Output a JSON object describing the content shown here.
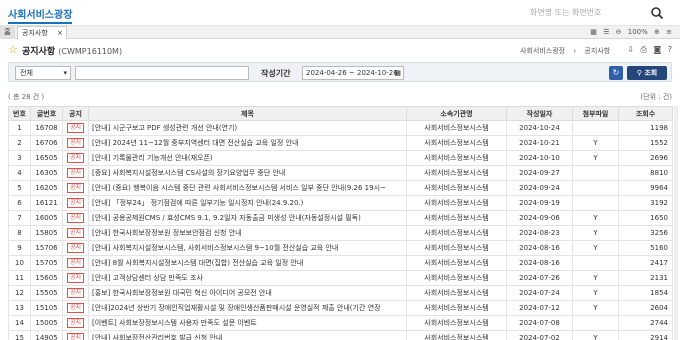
{
  "app": {
    "logo": "사회서비스광장",
    "screen_search_placeholder": "화면명 또는 화면번호"
  },
  "tabs": {
    "home": "홈",
    "active": "공지사항",
    "close": "×",
    "zoom": "100%"
  },
  "page": {
    "title": "공지사항",
    "code": "(CWMP16110M)",
    "breadcrumb": [
      "사회서비스광장",
      "공지사항"
    ]
  },
  "search": {
    "select_value": "전체",
    "keyword": "",
    "period_label": "작성기간",
    "period_value": "2024-04-26 ~ 2024-10-26",
    "query_label": "조회"
  },
  "list": {
    "count_text": "( 총 28 건 )",
    "unit_text": "(단위 : 건)",
    "headers": [
      "번호",
      "글번호",
      "공지",
      "제목",
      "소속기관명",
      "작성일자",
      "첨부파일",
      "조회수"
    ],
    "notice_badge": "공지",
    "rows": [
      [
        "1",
        "16708",
        "공지",
        "[안내] 시군구보고 PDF 생성관련 개선 안내(연기)",
        "사회서비스정보시스템",
        "2024-10-24",
        "",
        "1198"
      ],
      [
        "2",
        "16706",
        "공지",
        "[안내] 2024년 11~12월 중부지역센터 대면 전산실습 교육 일정 안내",
        "사회서비스정보시스템",
        "2024-10-21",
        "Y",
        "1552"
      ],
      [
        "3",
        "16505",
        "공지",
        "[안내] 기록물관리 기능개선 안내(재오픈)",
        "사회서비스정보시스템",
        "2024-10-10",
        "Y",
        "2696"
      ],
      [
        "4",
        "16305",
        "공지",
        "[중요] 사회복지시설정보시스템 CS사설의 장기요양업무 중단 안내",
        "사회서비스정보시스템",
        "2024-09-27",
        "",
        "8810"
      ],
      [
        "5",
        "16205",
        "공지",
        "[안내] (중요) 행복이음 시스템 중단 관련 사회서비스정보시스템 서비스 일부 중단 안내(9.26 19시~",
        "사회서비스정보시스템",
        "2024-09-24",
        "",
        "9964"
      ],
      [
        "6",
        "16121",
        "공지",
        "[안내] 「정부24」 정기점검에 따른 일부기능 일시정지 안내(24.9.20.)",
        "사회서비스정보시스템",
        "2024-09-19",
        "",
        "3192"
      ],
      [
        "7",
        "16005",
        "공지",
        "[안내] 공용공제원CMS / 효성CMS 9.1, 9.2일자 자동출금 미생성 안내(자동설정시설 필독)",
        "사회서비스정보시스템",
        "2024-09-06",
        "Y",
        "1650"
      ],
      [
        "8",
        "15805",
        "공지",
        "[안내] 한국사회보장정보원 정보보안점검 신청 안내",
        "사회서비스정보시스템",
        "2024-08-23",
        "Y",
        "3256"
      ],
      [
        "9",
        "15706",
        "공지",
        "[안내] 사회복지시설정보시스템, 사회서비스정보시스템 9~10월 전산실습 교육 안내",
        "사회서비스정보시스템",
        "2024-08-16",
        "Y",
        "5160"
      ],
      [
        "10",
        "15705",
        "공지",
        "[안내] 8월 사회복지시설정보시스템 대면(집합) 전산실습 교육 일정 안내",
        "사회서비스정보시스템",
        "2024-08-16",
        "",
        "2417"
      ],
      [
        "11",
        "15605",
        "공지",
        "[안내] 고객상담센터 상담 만족도 조사",
        "사회서비스정보시스템",
        "2024-07-26",
        "Y",
        "2131"
      ],
      [
        "12",
        "15505",
        "공지",
        "[홍보] 한국사회보장정보원 대국민 혁신 아이디어 공모전 안내",
        "사회서비스정보시스템",
        "2024-07-24",
        "Y",
        "1854"
      ],
      [
        "13",
        "15105",
        "공지",
        "[안내]2024년 상반기 장애인직업재활시설 및 장애인생산품판매시설 운영실적 제출 안내(기간 연장",
        "사회서비스정보시스템",
        "2024-07-12",
        "Y",
        "2604"
      ],
      [
        "14",
        "15005",
        "공지",
        "[이벤트] 사회보장정보시스템 사용자 만족도 설문 이벤트",
        "사회서비스정보시스템",
        "2024-07-08",
        "",
        "2744"
      ],
      [
        "15",
        "14905",
        "공지",
        "[안내] 사회보장전산관리번호 발급 신청 안내",
        "사회서비스정보시스템",
        "2024-07-02",
        "Y",
        "2914"
      ]
    ]
  }
}
